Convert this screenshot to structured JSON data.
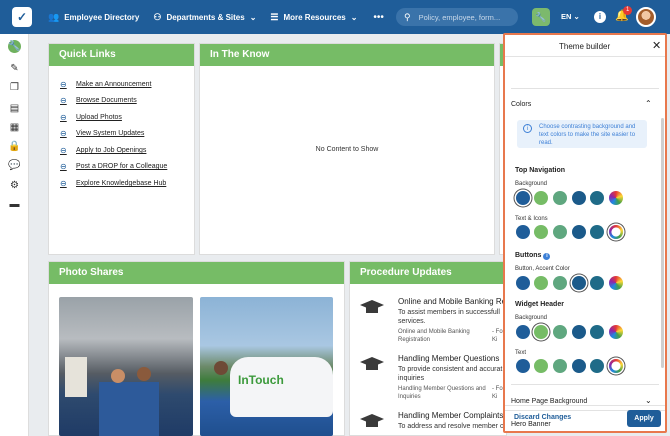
{
  "topnav": {
    "employee_directory": "Employee Directory",
    "departments_sites": "Departments & Sites",
    "more_resources": "More Resources",
    "search_placeholder": "Policy, employee, form...",
    "language": "EN",
    "notification_count": "1",
    "brand_color": "#1f5d99"
  },
  "quick_links": {
    "title": "Quick Links",
    "items": [
      "Make an Announcement",
      "Browse Documents",
      "Upload Photos",
      "View System Updates",
      "Apply to Job Openings",
      "Post a DROP for a Colleague",
      "Explore Knowledgebase Hub"
    ]
  },
  "in_the_know": {
    "title": "In The Know",
    "empty_text": "No Content to Show"
  },
  "photo_shares": {
    "title": "Photo Shares"
  },
  "procedure_updates": {
    "title": "Procedure Updates",
    "items": [
      {
        "title": "Online and Mobile Banking Re",
        "desc1": "To assist members in successfull",
        "desc2": "services.",
        "sub1": "Online and Mobile Banking",
        "sub2": "Registration",
        "sub_r1": "- Fo",
        "sub_r2": "Ki"
      },
      {
        "title": "Handling Member Questions",
        "desc1": "To provide consistent and accurat",
        "desc2": "inquiries",
        "sub1": "Handling Member Questions and",
        "sub2": "Inquiries",
        "sub_r1": "- Fo",
        "sub_r2": "Ki"
      },
      {
        "title": "Handling Member Complaints",
        "desc1": "To address and resolve member c",
        "desc2": "",
        "sub1": "",
        "sub2": "",
        "sub_r1": "",
        "sub_r2": ""
      }
    ]
  },
  "theme_builder": {
    "title": "Theme builder",
    "colors_section": "Colors",
    "info_text": "Choose contrasting background and text colors to make the site easier to read.",
    "top_navigation": "Top Navigation",
    "buttons": "Buttons",
    "widget_header": "Widget Header",
    "background_label": "Background",
    "text_icons_label": "Text & Icons",
    "button_accent_label": "Button, Accent Color",
    "text_label": "Text",
    "home_page_background": "Home Page Background",
    "hero_banner": "Hero Banner",
    "discard_changes": "Discard Changes",
    "apply": "Apply",
    "swatch_colors": [
      "#1f5d99",
      "#76bc66",
      "#5fa77f",
      "#1b5a8a",
      "#1f6b88"
    ]
  }
}
